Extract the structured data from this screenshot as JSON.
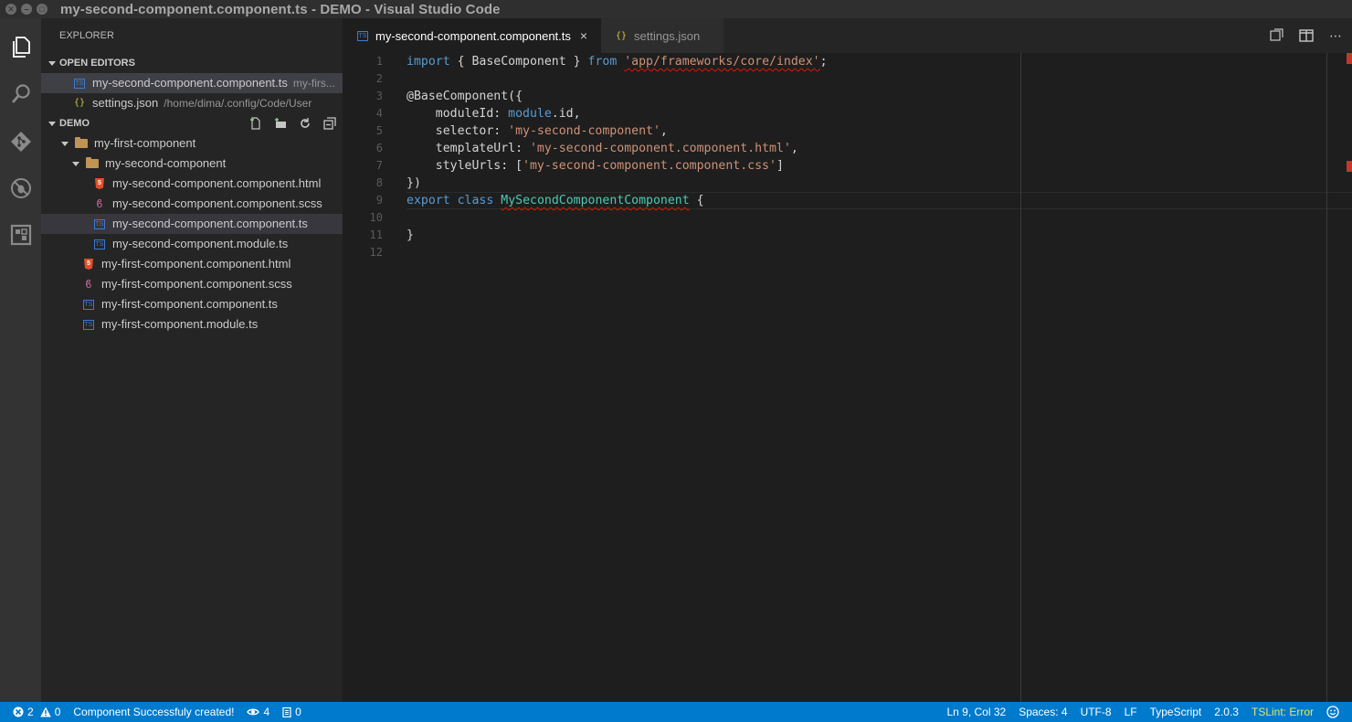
{
  "window": {
    "title": "my-second-component.component.ts - DEMO - Visual Studio Code"
  },
  "activity_bar": {
    "items": [
      "explorer-icon",
      "search-icon",
      "git-icon",
      "debug-icon",
      "extensions-icon"
    ]
  },
  "sidebar": {
    "title": "EXPLORER",
    "open_editors": {
      "header": "OPEN EDITORS",
      "items": [
        {
          "name": "my-second-component.component.ts",
          "desc": "my-firs...",
          "icon": "typescript-file-icon"
        },
        {
          "name": "settings.json",
          "desc": "/home/dima/.config/Code/User",
          "icon": "json-file-icon"
        }
      ]
    },
    "workspace": {
      "header": "DEMO",
      "tree": [
        {
          "label": "my-first-component",
          "type": "folder"
        },
        {
          "label": "my-second-component",
          "type": "folder"
        },
        {
          "label": "my-second-component.component.html",
          "type": "html"
        },
        {
          "label": "my-second-component.component.scss",
          "type": "scss"
        },
        {
          "label": "my-second-component.component.ts",
          "type": "ts"
        },
        {
          "label": "my-second-component.module.ts",
          "type": "ts"
        },
        {
          "label": "my-first-component.component.html",
          "type": "html"
        },
        {
          "label": "my-first-component.component.scss",
          "type": "scss"
        },
        {
          "label": "my-first-component.component.ts",
          "type": "ts"
        },
        {
          "label": "my-first-component.module.ts",
          "type": "ts"
        }
      ]
    }
  },
  "tabs": [
    {
      "label": "my-second-component.component.ts",
      "close": "×"
    },
    {
      "label": "settings.json"
    }
  ],
  "editor": {
    "line_numbers": [
      "1",
      "2",
      "3",
      "4",
      "5",
      "6",
      "7",
      "8",
      "9",
      "10",
      "11",
      "12"
    ],
    "code": {
      "l1_import": "import",
      "l1_open": " { BaseComponent } ",
      "l1_from": "from",
      "l1_space": " ",
      "l1_path": "'app/frameworks/core/index'",
      "l1_semi": ";",
      "l3": "@BaseComponent({",
      "l4_key": "    moduleId: ",
      "l4_mod": "module",
      "l4_rest": ".id,",
      "l5_key": "    selector: ",
      "l5_val": "'my-second-component'",
      "l5_rest": ",",
      "l6_key": "    templateUrl: ",
      "l6_val": "'my-second-component.component.html'",
      "l6_rest": ",",
      "l7_key": "    styleUrls: [",
      "l7_val": "'my-second-component.component.css'",
      "l7_rest": "]",
      "l8": "})",
      "l9_export": "export",
      "l9_sp1": " ",
      "l9_class": "class",
      "l9_sp2": " ",
      "l9_name": "MySecondComponentComponent",
      "l9_rest": " {",
      "l11": "}"
    }
  },
  "status_bar": {
    "errors": "2",
    "warnings": "0",
    "message": "Component Successfuly created!",
    "views": "4",
    "notifications": "0",
    "position": "Ln 9, Col 32",
    "spaces": "Spaces: 4",
    "encoding": "UTF-8",
    "eol": "LF",
    "language": "TypeScript",
    "version": "2.0.3",
    "tslint": "TSLint: Error"
  },
  "colors": {
    "accent": "#007acc",
    "keyword": "#569cd6",
    "string": "#ce9178",
    "class": "#4ec9b0",
    "error": "#e51400"
  }
}
